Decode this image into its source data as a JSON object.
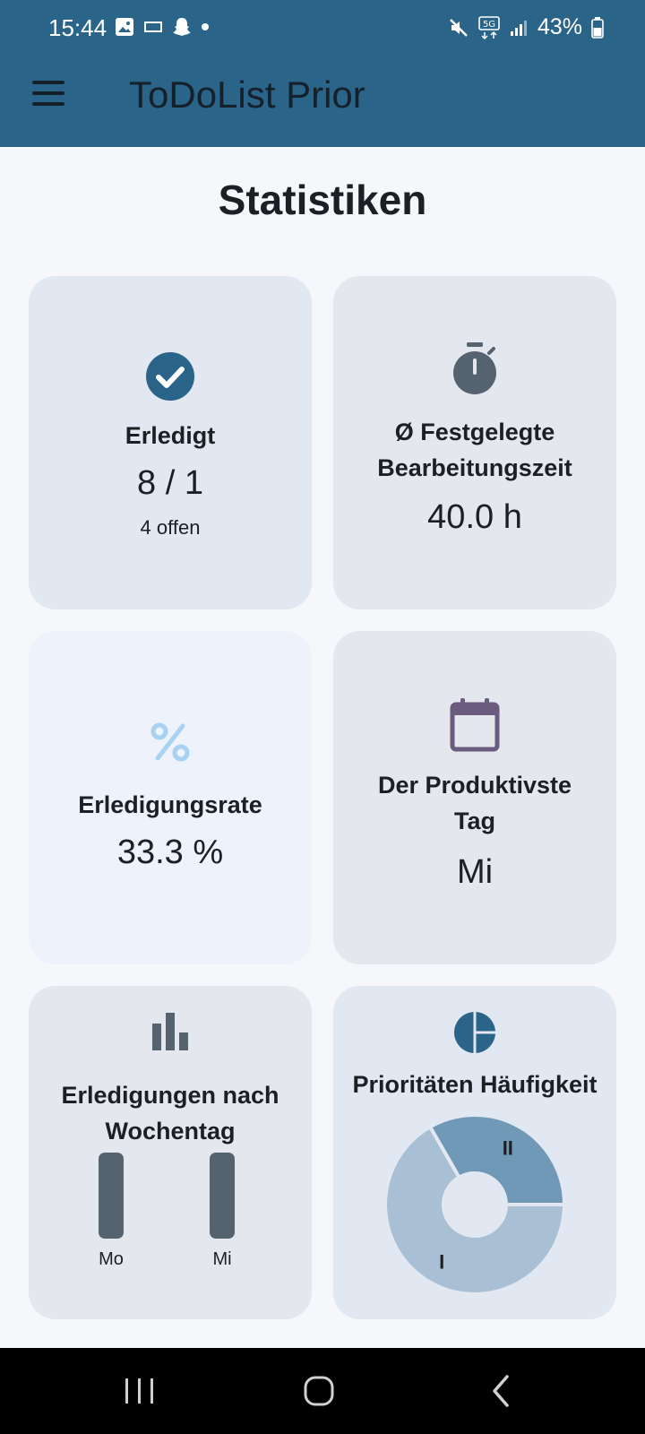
{
  "status_bar": {
    "time": "15:44",
    "battery": "43%",
    "network": "5G",
    "left_icons": [
      "gallery-icon",
      "app-icon",
      "snapchat-icon",
      "dot-icon"
    ],
    "right_icons": [
      "mute-icon",
      "5g-icon",
      "signal-icon",
      "battery-icon"
    ]
  },
  "app_bar": {
    "title": "ToDoList Prior"
  },
  "page": {
    "title": "Statistiken"
  },
  "cards": {
    "done": {
      "label": "Erledigt",
      "value": "8 / 1",
      "sub": "4 offen"
    },
    "avg_time": {
      "label_line1": "Ø Festgelegte",
      "label_line2": "Bearbeitungszeit",
      "value": "40.0 h"
    },
    "rate": {
      "label": "Erledigungsrate",
      "value": "33.3 %"
    },
    "productive_day": {
      "label_line1": "Der Produktivste",
      "label_line2": "Tag",
      "value": "Mi"
    },
    "weekday": {
      "label_line1": "Erledigungen nach",
      "label_line2": "Wochentag"
    },
    "priority": {
      "label": "Prioritäten Häufigkeit"
    }
  },
  "colors": {
    "accent": "#2b6489",
    "bar": "#556270",
    "pie_light": "#a9c0d4",
    "pie_dark": "#6f99b7"
  },
  "chart_data": [
    {
      "type": "bar",
      "categories": [
        "Mo",
        "Mi"
      ],
      "values": [
        1,
        1
      ],
      "title": "Erledigungen nach Wochentag"
    },
    {
      "type": "pie",
      "categories": [
        "I",
        "II"
      ],
      "values": [
        66.7,
        33.3
      ],
      "title": "Prioritäten Häufigkeit"
    }
  ]
}
